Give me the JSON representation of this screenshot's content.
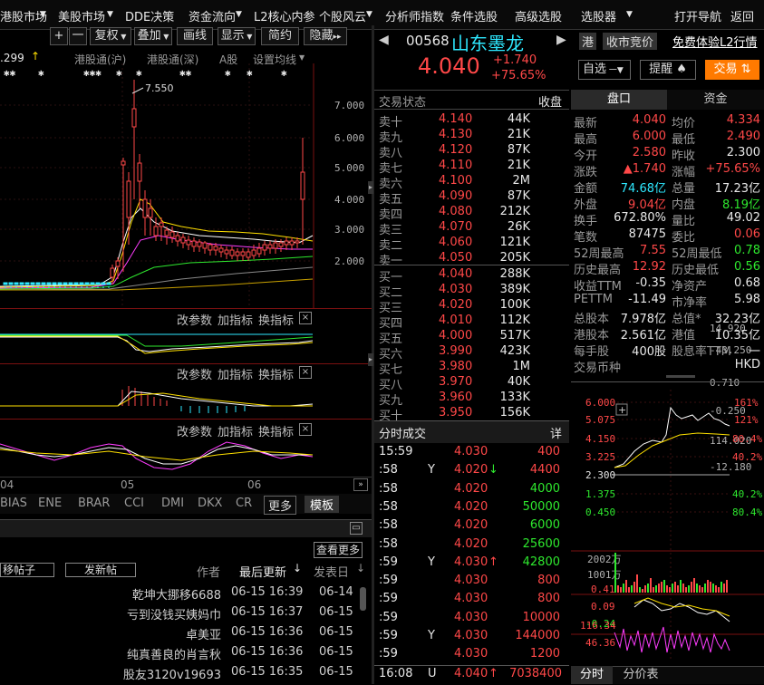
{
  "menu": {
    "items": [
      "港股市场",
      "美股市场",
      "DDE决策",
      "资金流向",
      "L2核心内参",
      "个股风云",
      "分析师指数",
      "条件选股",
      "高级选股",
      "选股器",
      "打开导航",
      "返回"
    ]
  },
  "chart_toolbar": {
    "plus": "+",
    "minus": "一",
    "buttons": [
      "复权",
      "叠加",
      "画线",
      "显示",
      "简约",
      "隐藏"
    ],
    "more_arrow": "▸▸"
  },
  "chart_header": {
    "price_label": ".299",
    "hk_sh": "港股通(沪)",
    "hk_sz": "港股通(深)",
    "a_share": "A股",
    "ma_setting": "设置均线"
  },
  "main_chart": {
    "y_ticks": [
      "7.000",
      "6.000",
      "5.000",
      "4.000",
      "3.000",
      "2.000"
    ],
    "peak_label": "7.550",
    "x_labels": [
      "04",
      "05",
      "06"
    ]
  },
  "indicators": [
    {
      "change_params": "改参数",
      "add_indicator": "加指标",
      "switch_indicator": "换指标",
      "close": "×",
      "y_top": "14.920",
      "y_bottom": "-43.250"
    },
    {
      "change_params": "改参数",
      "add_indicator": "加指标",
      "switch_indicator": "换指标",
      "close": "×",
      "y_top": "0.710",
      "y_bottom": "-0.250"
    },
    {
      "change_params": "改参数",
      "add_indicator": "加指标",
      "switch_indicator": "换指标",
      "close": "×",
      "y_top": "114.020",
      "y_bottom": "-12.180"
    }
  ],
  "indicator_tabs": [
    "BIAS",
    "ENE",
    "BRAR",
    "CCI",
    "DMI",
    "DKX",
    "CR",
    "更多",
    "模板"
  ],
  "forum": {
    "more_label": "查看更多",
    "move_post": "移帖子",
    "new_post": "发新帖",
    "col_author": "作者",
    "col_last_update": "最后更新",
    "col_post_date": "发表日",
    "rows": [
      {
        "author": "乾坤大挪移6688",
        "last": "06-15 16:39",
        "date": "06-14"
      },
      {
        "author": "亏到没钱买姨妈巾",
        "last": "06-15 16:37",
        "date": "06-15"
      },
      {
        "author": "卓美亚",
        "last": "06-15 16:36",
        "date": "06-15"
      },
      {
        "author": "纯真善良的肖言秋",
        "last": "06-15 16:36",
        "date": "06-15"
      },
      {
        "author": "股友3120v19693",
        "last": "06-15 16:35",
        "date": "06-15"
      }
    ]
  },
  "stock": {
    "code": "00568",
    "name": "山东墨龙",
    "tag_hk": "港",
    "auction": "收市竞价",
    "l2_trial": "免费体验L2行情",
    "price": "4.040",
    "change": "+1.740",
    "change_pct": "+75.65%",
    "watchlist": "自选",
    "alert": "提醒",
    "trade": "交易"
  },
  "orderbook": {
    "status_label": "交易状态",
    "status_value": "收盘",
    "asks": [
      {
        "label": "卖十",
        "price": "4.140",
        "vol": "44K"
      },
      {
        "label": "卖九",
        "price": "4.130",
        "vol": "21K"
      },
      {
        "label": "卖八",
        "price": "4.120",
        "vol": "87K"
      },
      {
        "label": "卖七",
        "price": "4.110",
        "vol": "21K"
      },
      {
        "label": "卖六",
        "price": "4.100",
        "vol": "2M"
      },
      {
        "label": "卖五",
        "price": "4.090",
        "vol": "87K"
      },
      {
        "label": "卖四",
        "price": "4.080",
        "vol": "212K"
      },
      {
        "label": "卖三",
        "price": "4.070",
        "vol": "26K"
      },
      {
        "label": "卖二",
        "price": "4.060",
        "vol": "121K"
      },
      {
        "label": "卖一",
        "price": "4.050",
        "vol": "205K"
      }
    ],
    "bids": [
      {
        "label": "买一",
        "price": "4.040",
        "vol": "288K"
      },
      {
        "label": "买二",
        "price": "4.030",
        "vol": "389K"
      },
      {
        "label": "买三",
        "price": "4.020",
        "vol": "100K"
      },
      {
        "label": "买四",
        "price": "4.010",
        "vol": "112K"
      },
      {
        "label": "买五",
        "price": "4.000",
        "vol": "517K"
      },
      {
        "label": "买六",
        "price": "3.990",
        "vol": "423K"
      },
      {
        "label": "买七",
        "price": "3.980",
        "vol": "1M"
      },
      {
        "label": "买八",
        "price": "3.970",
        "vol": "40K"
      },
      {
        "label": "买九",
        "price": "3.960",
        "vol": "133K"
      },
      {
        "label": "买十",
        "price": "3.950",
        "vol": "156K"
      }
    ]
  },
  "trades": {
    "title": "分时成交",
    "detail": "详",
    "rows": [
      {
        "time": "15:59",
        "flag": "",
        "price": "4.030",
        "arrow": "",
        "vol": "400",
        "pc": "red",
        "vc": "red"
      },
      {
        "time": ":58",
        "flag": "Y",
        "price": "4.020",
        "arrow": "↓",
        "vol": "4400",
        "pc": "red",
        "vc": "red"
      },
      {
        "time": ":58",
        "flag": "",
        "price": "4.020",
        "arrow": "",
        "vol": "4000",
        "pc": "red",
        "vc": "green"
      },
      {
        "time": ":58",
        "flag": "",
        "price": "4.020",
        "arrow": "",
        "vol": "50000",
        "pc": "red",
        "vc": "green"
      },
      {
        "time": ":58",
        "flag": "",
        "price": "4.020",
        "arrow": "",
        "vol": "6000",
        "pc": "red",
        "vc": "green"
      },
      {
        "time": ":58",
        "flag": "",
        "price": "4.020",
        "arrow": "",
        "vol": "25600",
        "pc": "red",
        "vc": "green"
      },
      {
        "time": ":59",
        "flag": "Y",
        "price": "4.030",
        "arrow": "↑",
        "vol": "42800",
        "pc": "red",
        "vc": "green"
      },
      {
        "time": ":59",
        "flag": "",
        "price": "4.030",
        "arrow": "",
        "vol": "800",
        "pc": "red",
        "vc": "red"
      },
      {
        "time": ":59",
        "flag": "",
        "price": "4.030",
        "arrow": "",
        "vol": "800",
        "pc": "red",
        "vc": "red"
      },
      {
        "time": ":59",
        "flag": "",
        "price": "4.030",
        "arrow": "",
        "vol": "10000",
        "pc": "red",
        "vc": "red"
      },
      {
        "time": ":59",
        "flag": "Y",
        "price": "4.030",
        "arrow": "",
        "vol": "144000",
        "pc": "red",
        "vc": "red"
      },
      {
        "time": ":59",
        "flag": "",
        "price": "4.030",
        "arrow": "",
        "vol": "1200",
        "pc": "red",
        "vc": "red"
      }
    ],
    "last": {
      "time": "16:08",
      "flag": "U",
      "price": "4.040",
      "arrow": "↑",
      "vol": "7038400"
    }
  },
  "stats_tabs": {
    "pankou": "盘口",
    "capital": "资金"
  },
  "stats": [
    {
      "l1": "最新",
      "v1": "4.040",
      "c1": "red",
      "l2": "均价",
      "v2": "4.334",
      "c2": "red"
    },
    {
      "l1": "最高",
      "v1": "6.000",
      "c1": "red",
      "l2": "最低",
      "v2": "2.490",
      "c2": "red"
    },
    {
      "l1": "今开",
      "v1": "2.580",
      "c1": "red",
      "l2": "昨收",
      "v2": "2.300",
      "c2": "white"
    },
    {
      "l1": "涨跌",
      "v1": "▲1.740",
      "c1": "red",
      "l2": "涨幅",
      "v2": "+75.65%",
      "c2": "red"
    },
    {
      "l1": "金额",
      "v1": "74.68亿",
      "c1": "cyan",
      "l2": "总量",
      "v2": "17.23亿",
      "c2": "white"
    },
    {
      "l1": "外盘",
      "v1": "9.04亿",
      "c1": "red",
      "l2": "内盘",
      "v2": "8.19亿",
      "c2": "green"
    },
    {
      "l1": "换手",
      "v1": "672.80%",
      "c1": "white",
      "l2": "量比",
      "v2": "49.02",
      "c2": "white"
    },
    {
      "l1": "笔数",
      "v1": "87475",
      "c1": "white",
      "l2": "委比",
      "v2": "0.06",
      "c2": "red"
    },
    {
      "l1": "52周最高",
      "v1": "7.55",
      "c1": "red",
      "l2": "52周最低",
      "v2": "0.78",
      "c2": "green"
    },
    {
      "l1": "历史最高",
      "v1": "12.92",
      "c1": "red",
      "l2": "历史最低",
      "v2": "0.56",
      "c2": "green"
    },
    {
      "l1": "收益TTM",
      "v1": "-0.35",
      "c1": "white",
      "l2": "净资产",
      "v2": "0.68",
      "c2": "white"
    },
    {
      "l1": "PETTM",
      "v1": "-11.49",
      "c1": "white",
      "l2": "市净率",
      "v2": "5.98",
      "c2": "white"
    },
    {
      "l1": "总股本",
      "v1": "7.978亿",
      "c1": "white",
      "l2": "总值*",
      "v2": "32.23亿",
      "c2": "white"
    },
    {
      "l1": "港股本",
      "v1": "2.561亿",
      "c1": "white",
      "l2": "港值",
      "v2": "10.35亿",
      "c2": "white"
    },
    {
      "l1": "每手股",
      "v1": "400股",
      "c1": "white",
      "l2": "股息率TTM",
      "v2": "一",
      "c2": "white"
    },
    {
      "l1": "交易币种",
      "v1": "",
      "c1": "white",
      "l2": "",
      "v2": "HKD",
      "c2": "white"
    }
  ],
  "mini_chart": {
    "left_ticks": [
      "6.000",
      "5.075",
      "4.150",
      "3.225",
      "2.300",
      "1.375",
      "0.450"
    ],
    "right_ticks": [
      "161%",
      "121%",
      "80.4%",
      "40.2%",
      "",
      "40.2%",
      "80.4%"
    ],
    "vol_ticks": [
      "2002万",
      "1001万"
    ],
    "ind1_ticks": [
      "0.41",
      "0.09",
      "-0.24"
    ],
    "ind2_ticks": [
      "116.34",
      "46.36"
    ],
    "tab_timeshare": "分时",
    "tab_price_table": "分价表"
  },
  "colors": {
    "up": "#ff4848",
    "down": "#2ee82e",
    "accent": "#ff7a00",
    "bg": "#000000"
  }
}
